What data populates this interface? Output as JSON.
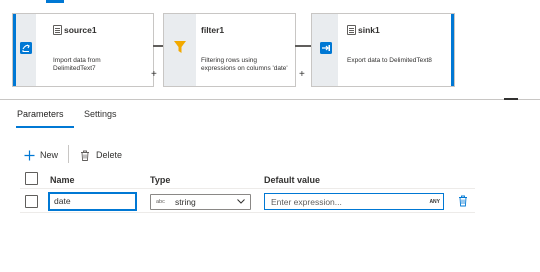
{
  "flow": {
    "nodes": [
      {
        "title": "source1",
        "description": "Import data from DelimitedText7",
        "icon": "source-icon",
        "title_icon": "dataset-icon"
      },
      {
        "title": "filter1",
        "description": "Filtering rows using expressions on columns 'date'",
        "icon": "filter-funnel-icon",
        "title_icon": ""
      },
      {
        "title": "sink1",
        "description": "Export data to DelimitedText8",
        "icon": "sink-icon",
        "title_icon": "dataset-icon"
      }
    ],
    "add_symbol": "+"
  },
  "tabs": [
    {
      "label": "Parameters",
      "active": true
    },
    {
      "label": "Settings",
      "active": false
    }
  ],
  "commands": {
    "new_label": "New",
    "delete_label": "Delete"
  },
  "grid": {
    "columns": [
      "Name",
      "Type",
      "Default value"
    ],
    "rows": [
      {
        "name": "date",
        "type_badge": "abc",
        "type": "string",
        "default_placeholder": "Enter expression...",
        "default_badge": "ANY"
      }
    ]
  },
  "colors": {
    "accent": "#0078d4",
    "filter_icon": "#f2a900",
    "source_icon": "#0078d4"
  }
}
